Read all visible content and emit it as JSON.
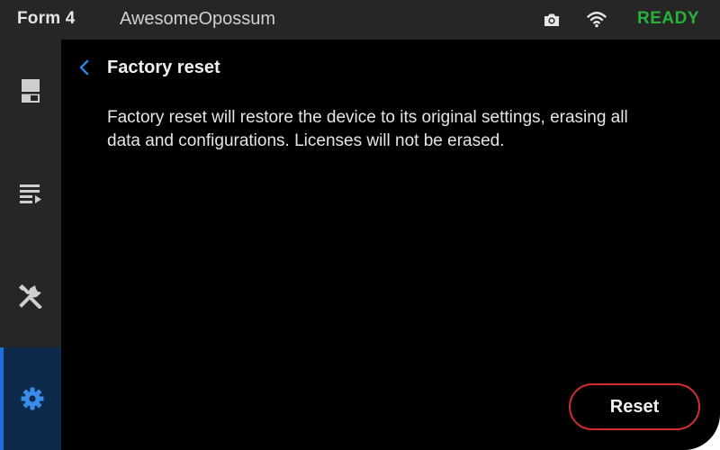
{
  "header": {
    "model": "Form 4",
    "printer_name": "AwesomeOpossum",
    "status": "READY",
    "status_color": "#27b33a",
    "icons": [
      "camera-icon",
      "wifi-icon"
    ]
  },
  "sidebar": {
    "items": [
      {
        "name": "printer",
        "icon": "printer-icon",
        "active": false
      },
      {
        "name": "queue",
        "icon": "queue-icon",
        "active": false
      },
      {
        "name": "tools",
        "icon": "tools-icon",
        "active": false
      },
      {
        "name": "settings",
        "icon": "gear-icon",
        "active": true
      }
    ],
    "active_color": "#1f6fd6"
  },
  "main": {
    "title": "Factory reset",
    "description": "Factory reset will restore the device to its original settings, erasing all data and configurations. Licenses will not be erased.",
    "reset_label": "Reset",
    "accent_color": "#1f6fd6",
    "danger_color": "#d32f2f"
  }
}
